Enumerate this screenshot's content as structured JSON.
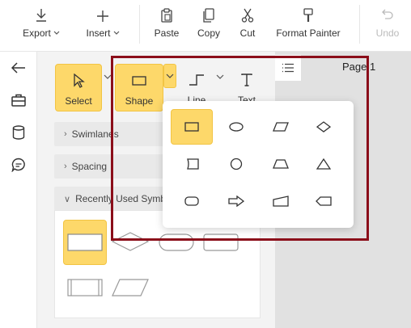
{
  "toolbar": {
    "export": "Export",
    "insert": "Insert",
    "paste": "Paste",
    "copy": "Copy",
    "cut": "Cut",
    "format_painter": "Format Painter",
    "undo": "Undo"
  },
  "rail": {
    "items": [
      "back-arrow",
      "toolbox",
      "database",
      "comment"
    ]
  },
  "tools": {
    "select": "Select",
    "shape": "Shape",
    "line": "Line",
    "text": "Text"
  },
  "sections": {
    "swimlanes": "Swimlanes",
    "spacing": "Spacing",
    "recent": "Recently Used Symb"
  },
  "canvas": {
    "page_label": "Page 1"
  },
  "popup": {
    "shapes": [
      "rectangle",
      "ellipse",
      "parallelogram",
      "diamond",
      "tape",
      "circle",
      "trapezoid",
      "triangle",
      "rounded-rectangle",
      "arrow-right",
      "manual-input",
      "display"
    ],
    "selected": "rectangle"
  },
  "colors": {
    "accent": "#fdd86a",
    "accent_border": "#f2c443",
    "highlight_frame": "#8b0e1a"
  }
}
